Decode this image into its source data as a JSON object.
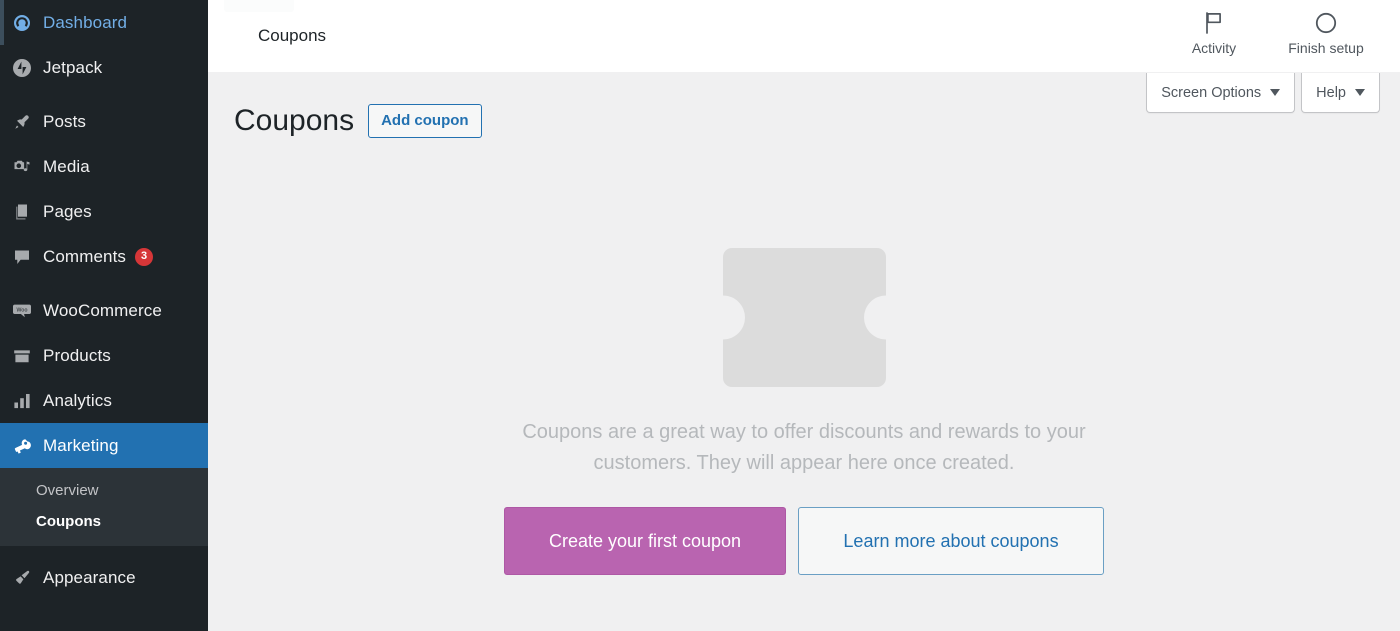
{
  "sidebar": {
    "items": [
      {
        "label": "Dashboard",
        "icon": "dashboard-icon",
        "state": "hovered",
        "badge": null
      },
      {
        "label": "Jetpack",
        "icon": "jetpack-icon",
        "state": "default",
        "badge": null
      },
      {
        "label": "Posts",
        "icon": "pushpin-icon",
        "state": "default",
        "badge": null
      },
      {
        "label": "Media",
        "icon": "media-icon",
        "state": "default",
        "badge": null
      },
      {
        "label": "Pages",
        "icon": "pages-icon",
        "state": "default",
        "badge": null
      },
      {
        "label": "Comments",
        "icon": "comments-icon",
        "state": "default",
        "badge": "3"
      },
      {
        "label": "WooCommerce",
        "icon": "woocommerce-icon",
        "state": "default",
        "badge": null
      },
      {
        "label": "Products",
        "icon": "products-icon",
        "state": "default",
        "badge": null
      },
      {
        "label": "Analytics",
        "icon": "analytics-icon",
        "state": "default",
        "badge": null
      },
      {
        "label": "Marketing",
        "icon": "megaphone-icon",
        "state": "current",
        "badge": null
      }
    ],
    "submenu": [
      {
        "label": "Overview",
        "active": false
      },
      {
        "label": "Coupons",
        "active": true
      }
    ],
    "after_submenu": [
      {
        "label": "Appearance",
        "icon": "paintbrush-icon",
        "state": "default",
        "badge": null
      }
    ],
    "colors": {
      "background": "#1d2327",
      "submenu_background": "#2c3338",
      "current_background": "#2271b1",
      "hover_text": "#72aee6",
      "badge_background": "#d63638"
    }
  },
  "header": {
    "title": "Coupons",
    "buttons": [
      {
        "label": "Activity",
        "icon": "flag-icon"
      },
      {
        "label": "Finish setup",
        "icon": "circle-progress-icon"
      }
    ]
  },
  "screen_meta": {
    "screen_options_label": "Screen Options",
    "help_label": "Help",
    "caret_icon": "chevron-down-icon"
  },
  "page": {
    "title": "Coupons",
    "add_button_label": "Add coupon"
  },
  "empty_state": {
    "illustration": "coupon-ticket-icon",
    "message": "Coupons are a great way to offer discounts and rewards to your customers. They will appear here once created.",
    "primary_button_label": "Create your first coupon",
    "secondary_button_label": "Learn more about coupons",
    "colors": {
      "primary_button": "#b964b0",
      "secondary_button_text": "#2271b1",
      "message_text": "#b5b8bb",
      "illustration": "#dcdcdc"
    }
  }
}
